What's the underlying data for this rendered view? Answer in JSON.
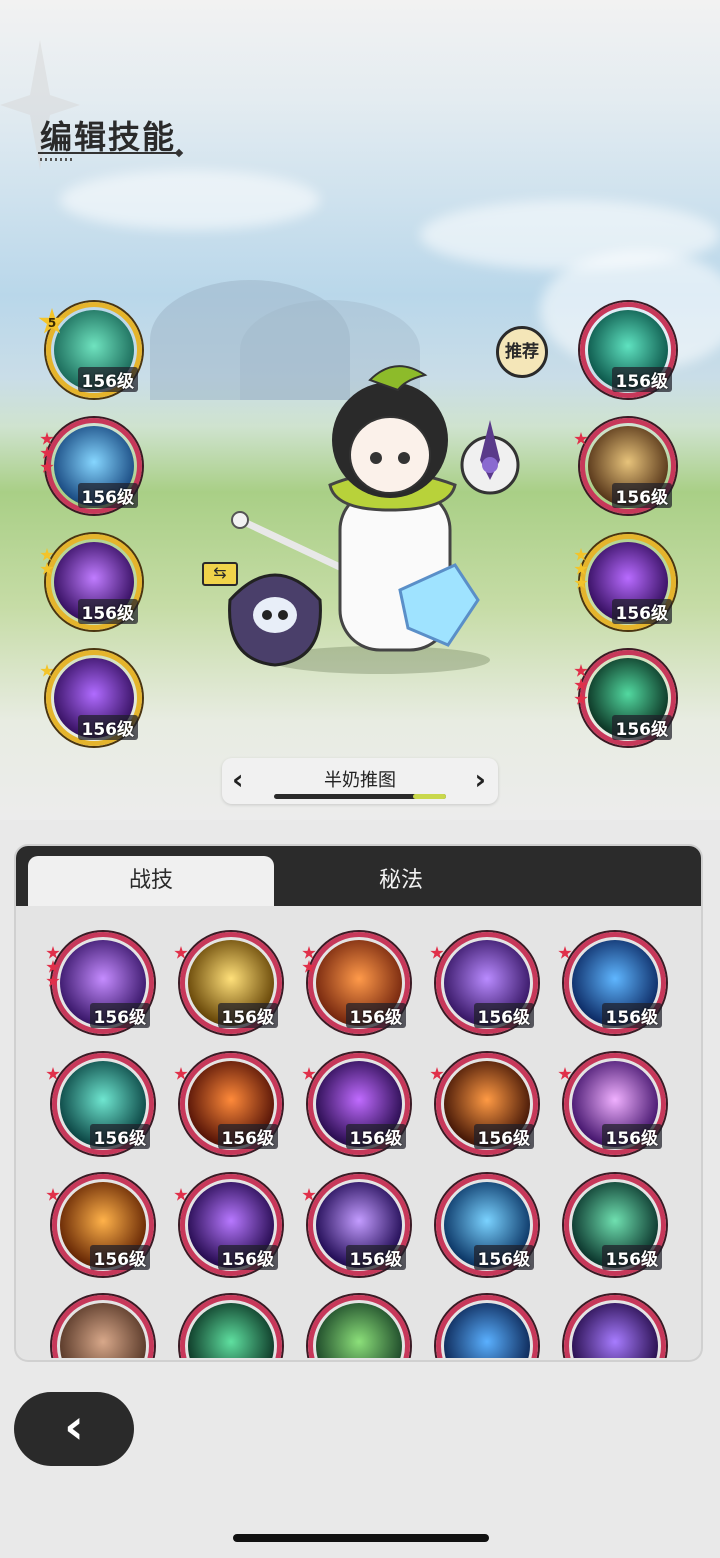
{
  "title": "编辑技能",
  "recommend_label": "推荐",
  "swap_icon": "⇆",
  "preset": {
    "name": "半奶推图",
    "prev_icon": "‹",
    "next_icon": "›",
    "progress": 0.81
  },
  "equipped_left": [
    {
      "level": "156级",
      "badge": "5",
      "stars": [],
      "ring": "gold",
      "core": [
        "#1e6f5e",
        "#6fe3bf"
      ]
    },
    {
      "level": "156级",
      "stars": [
        "r",
        "r",
        "r"
      ],
      "ring": "red",
      "core": [
        "#1d4f86",
        "#86d6ff"
      ]
    },
    {
      "level": "156级",
      "stars": [
        "y",
        "y"
      ],
      "ring": "gold",
      "core": [
        "#3a1266",
        "#c07cff"
      ]
    },
    {
      "level": "156级",
      "stars": [
        "y"
      ],
      "ring": "gold",
      "core": [
        "#3b1468",
        "#b06bff"
      ]
    }
  ],
  "equipped_right": [
    {
      "level": "156级",
      "stars": [],
      "ring": "red",
      "core": [
        "#0f5c4f",
        "#5fe2c0"
      ]
    },
    {
      "level": "156级",
      "stars": [
        "r"
      ],
      "ring": "red",
      "core": [
        "#5b3a1c",
        "#e7c37b"
      ]
    },
    {
      "level": "156级",
      "stars": [
        "y",
        "y",
        "y"
      ],
      "ring": "gold",
      "core": [
        "#3a1266",
        "#b86bff"
      ]
    },
    {
      "level": "156级",
      "stars": [
        "r",
        "r",
        "r"
      ],
      "ring": "red",
      "core": [
        "#0e3a28",
        "#52d9a0"
      ]
    }
  ],
  "tabs": {
    "active": "战技",
    "inactive": "秘法"
  },
  "skill_grid": [
    {
      "level": "156级",
      "stars": [
        "r",
        "r",
        "r"
      ],
      "core": [
        "#3d1a6e",
        "#c58cff"
      ]
    },
    {
      "level": "156级",
      "stars": [
        "r"
      ],
      "core": [
        "#6b4a0a",
        "#ffe07a"
      ]
    },
    {
      "level": "156级",
      "stars": [
        "r",
        "r"
      ],
      "core": [
        "#7a2a10",
        "#ff9a4a"
      ]
    },
    {
      "level": "156级",
      "stars": [
        "r"
      ],
      "core": [
        "#3b1a6a",
        "#b98bff"
      ]
    },
    {
      "level": "156级",
      "stars": [
        "r"
      ],
      "core": [
        "#0f2f6a",
        "#5fb6ff"
      ]
    },
    {
      "level": "156级",
      "stars": [
        "r"
      ],
      "core": [
        "#0e4a48",
        "#6fe6d0"
      ]
    },
    {
      "level": "156级",
      "stars": [
        "r"
      ],
      "core": [
        "#5a1608",
        "#ff8a3a"
      ]
    },
    {
      "level": "156级",
      "stars": [
        "r"
      ],
      "core": [
        "#2e0f55",
        "#c06bff"
      ]
    },
    {
      "level": "156级",
      "stars": [
        "r"
      ],
      "core": [
        "#4a1a08",
        "#ff9a44"
      ]
    },
    {
      "level": "156级",
      "stars": [
        "r"
      ],
      "core": [
        "#4a1a72",
        "#f0b0ff"
      ]
    },
    {
      "level": "156级",
      "stars": [
        "r"
      ],
      "core": [
        "#6a2a06",
        "#ffb24a"
      ]
    },
    {
      "level": "156级",
      "stars": [
        "r"
      ],
      "core": [
        "#2a0e55",
        "#b778ff"
      ]
    },
    {
      "level": "156级",
      "stars": [
        "r"
      ],
      "core": [
        "#26105a",
        "#c39cff"
      ]
    },
    {
      "level": "156级",
      "stars": [],
      "core": [
        "#0e3a6a",
        "#7ad2ff"
      ]
    },
    {
      "level": "156级",
      "stars": [],
      "core": [
        "#0e3a30",
        "#6fe0b0"
      ]
    },
    {
      "level": "",
      "stars": [],
      "core": [
        "#5a3a2a",
        "#d8a88a"
      ]
    },
    {
      "level": "",
      "stars": [],
      "core": [
        "#0e3a28",
        "#5fe0a0"
      ]
    },
    {
      "level": "",
      "stars": [],
      "core": [
        "#1e4a2a",
        "#8ce07a"
      ]
    },
    {
      "level": "",
      "stars": [],
      "core": [
        "#0e2a5a",
        "#5ab0ff"
      ]
    },
    {
      "level": "",
      "stars": [],
      "core": [
        "#2a1050",
        "#a77cff"
      ]
    }
  ],
  "back_icon": "‹"
}
